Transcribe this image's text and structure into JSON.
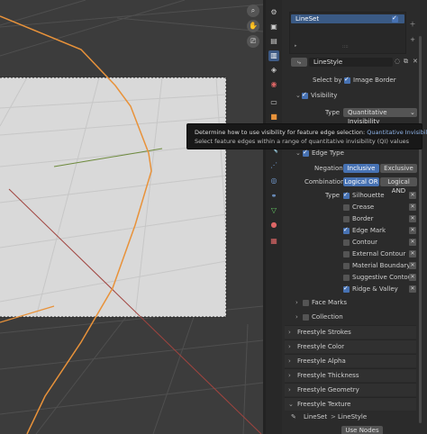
{
  "viewport": {
    "tools": [
      "zoom-icon",
      "hand-icon",
      "camera-icon"
    ]
  },
  "props": {
    "lineset_list": {
      "items": [
        {
          "label": "LineSet",
          "checked": true
        }
      ]
    },
    "linestyle": {
      "name": "LineStyle"
    },
    "select_by": {
      "label": "Select by",
      "option": "Image Border",
      "checked": true
    },
    "visibility": {
      "label": "Visibility",
      "checked": true,
      "type_label": "Type",
      "type_value": "Quantitative Invisibility"
    },
    "edge_type": {
      "label": "Edge Type",
      "checked": true,
      "negation_label": "Negation",
      "negation_options": [
        "Inclusive",
        "Exclusive"
      ],
      "negation_selected": "Inclusive",
      "combination_label": "Combination",
      "combination_options": [
        "Logical OR",
        "Logical AND"
      ],
      "combination_selected": "Logical OR",
      "type_label": "Type",
      "types": [
        {
          "label": "Silhouette",
          "checked": true
        },
        {
          "label": "Crease",
          "checked": false
        },
        {
          "label": "Border",
          "checked": false
        },
        {
          "label": "Edge Mark",
          "checked": true
        },
        {
          "label": "Contour",
          "checked": false
        },
        {
          "label": "External Contour",
          "checked": false
        },
        {
          "label": "Material Boundary",
          "checked": false
        },
        {
          "label": "Suggestive Contour",
          "checked": false
        },
        {
          "label": "Ridge & Valley",
          "checked": true
        }
      ]
    },
    "face_marks": {
      "label": "Face Marks"
    },
    "collection": {
      "label": "Collection"
    },
    "sections": [
      "Freestyle Strokes",
      "Freestyle Color",
      "Freestyle Alpha",
      "Freestyle Thickness",
      "Freestyle Geometry",
      "Freestyle Texture"
    ],
    "texture": {
      "lineset": "LineSet",
      "separator": ">",
      "linestyle": "LineStyle",
      "use_nodes": "Use Nodes"
    }
  },
  "tooltip": {
    "prefix": "Determine how to use visibility for feature edge selection:",
    "value": "Quantitative Invisibility",
    "description": "Select feature edges within a range of quantitative invisibility (QI) values"
  },
  "colors": {
    "accent": "#4772b3",
    "orange_edge": "#e8923a",
    "x_axis": "#a0443f",
    "y_axis": "#6d8a3c"
  }
}
